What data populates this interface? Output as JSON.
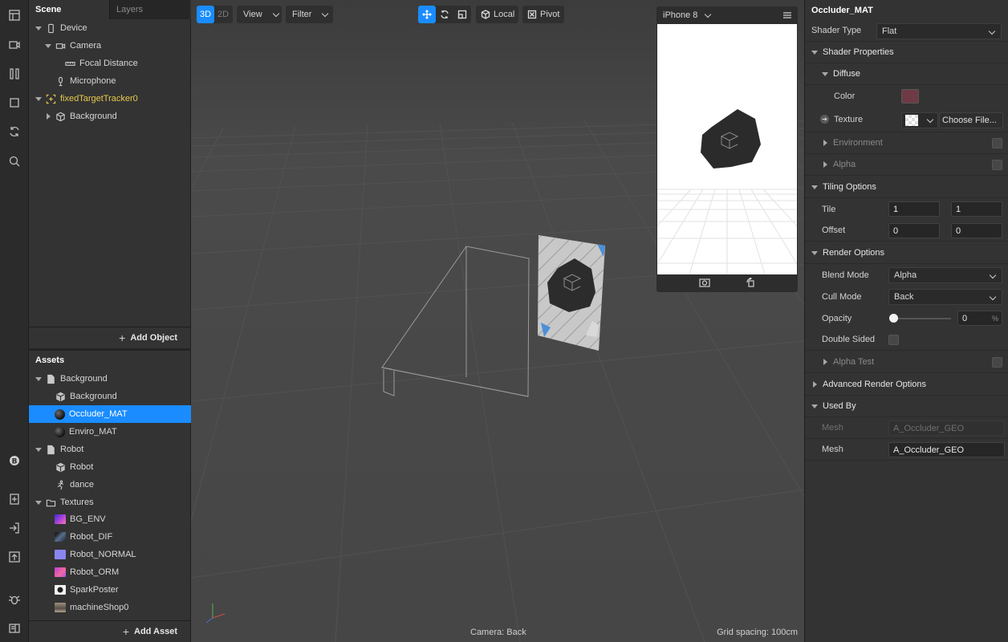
{
  "rail": {
    "icons": [
      "layout-icon",
      "video-icon",
      "columns-icon",
      "square-icon",
      "refresh-icon",
      "search-icon",
      "bitcoin-icon",
      "import-icon",
      "login-icon",
      "upload-icon",
      "bug-icon",
      "console-icon"
    ]
  },
  "scene_panel": {
    "tabs": {
      "scene": "Scene",
      "layers": "Layers"
    },
    "tree": [
      {
        "label": "Device",
        "icon": "phone-icon"
      },
      {
        "label": "Camera",
        "icon": "camera-icon"
      },
      {
        "label": "Focal Distance",
        "icon": "ruler-icon"
      },
      {
        "label": "Microphone",
        "icon": "microphone-icon"
      },
      {
        "label": "fixedTargetTracker0",
        "icon": "tracker-icon"
      },
      {
        "label": "Background",
        "icon": "cube-icon"
      }
    ],
    "add_object": "Add Object"
  },
  "assets_panel": {
    "title": "Assets",
    "tree": [
      {
        "label": "Background",
        "icon": "file-icon"
      },
      {
        "label": "Background",
        "icon": "cube-icon"
      },
      {
        "label": "Occluder_MAT",
        "icon": "material-sphere-icon"
      },
      {
        "label": "Enviro_MAT",
        "icon": "material-sphere-icon"
      },
      {
        "label": "Robot",
        "icon": "file-icon"
      },
      {
        "label": "Robot",
        "icon": "cube-icon"
      },
      {
        "label": "dance",
        "icon": "animation-icon"
      },
      {
        "label": "Textures",
        "icon": "folder-icon"
      },
      {
        "label": "BG_ENV",
        "icon": "texture-thumbnail"
      },
      {
        "label": "Robot_DIF",
        "icon": "texture-thumbnail"
      },
      {
        "label": "Robot_NORMAL",
        "icon": "texture-thumbnail"
      },
      {
        "label": "Robot_ORM",
        "icon": "texture-thumbnail"
      },
      {
        "label": "SparkPoster",
        "icon": "texture-thumbnail"
      },
      {
        "label": "machineShop0",
        "icon": "texture-thumbnail"
      }
    ],
    "add_asset": "Add Asset"
  },
  "viewport": {
    "toolbar": {
      "mode_3d": "3D",
      "mode_2d": "2D",
      "view": "View",
      "filter": "Filter",
      "local": "Local",
      "pivot": "Pivot"
    },
    "device_preview": {
      "device": "iPhone 8"
    },
    "camera_label": "Camera: Back",
    "grid_label": "Grid spacing: 100cm"
  },
  "inspector": {
    "title": "Occluder_MAT",
    "shader_type": {
      "label": "Shader Type",
      "value": "Flat"
    },
    "shader_properties": "Shader Properties",
    "diffuse": "Diffuse",
    "color": {
      "label": "Color",
      "value": "#6e3a43"
    },
    "texture": {
      "label": "Texture",
      "button": "Choose File..."
    },
    "environment": "Environment",
    "alpha": "Alpha",
    "tiling_options": "Tiling Options",
    "tile": {
      "label": "Tile",
      "x": "1",
      "y": "1"
    },
    "offset": {
      "label": "Offset",
      "x": "0",
      "y": "0"
    },
    "render_options": "Render Options",
    "blend_mode": {
      "label": "Blend Mode",
      "value": "Alpha"
    },
    "cull_mode": {
      "label": "Cull Mode",
      "value": "Back"
    },
    "opacity": {
      "label": "Opacity",
      "value": "0",
      "unit": "%"
    },
    "double_sided": "Double Sided",
    "alpha_test": "Alpha Test",
    "advanced_render_options": "Advanced Render Options",
    "used_by": "Used By",
    "mesh_placeholder": {
      "label": "Mesh",
      "value": "A_Occluder_GEO"
    },
    "mesh": {
      "label": "Mesh",
      "value": "A_Occluder_GEO"
    }
  }
}
